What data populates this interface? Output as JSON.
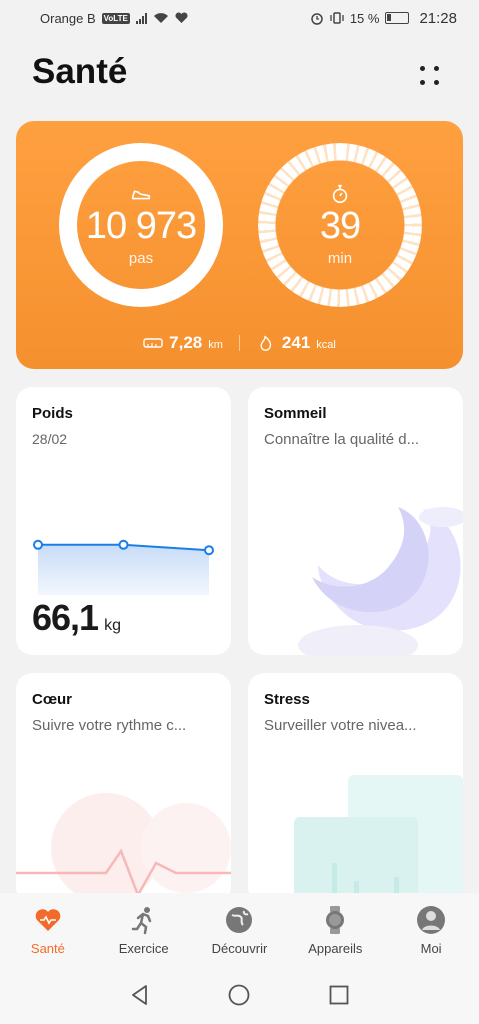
{
  "status_bar": {
    "carrier": "Orange B",
    "volte": "VoLTE",
    "battery_percent": "15 %",
    "time": "21:28"
  },
  "header": {
    "title": "Santé",
    "menu_icon": "more-dots-icon"
  },
  "activity": {
    "steps_value": "10 973",
    "steps_unit": "pas",
    "steps_icon": "shoe-icon",
    "minutes_value": "39",
    "minutes_unit": "min",
    "minutes_icon": "stopwatch-icon",
    "distance_value": "7,28",
    "distance_unit": "km",
    "calories_value": "241",
    "calories_unit": "kcal",
    "accent": "#f7922f"
  },
  "tiles": {
    "weight": {
      "title": "Poids",
      "date": "28/02",
      "value": "66,1",
      "unit": "kg",
      "chart_points": [
        0.58,
        0.58,
        0.52
      ]
    },
    "sleep": {
      "title": "Sommeil",
      "subtitle": "Connaître la qualité d..."
    },
    "heart": {
      "title": "Cœur",
      "subtitle": "Suivre votre rythme c..."
    },
    "stress": {
      "title": "Stress",
      "subtitle": "Surveiller votre nivea..."
    }
  },
  "nav": {
    "items": [
      {
        "label": "Santé",
        "icon": "heart-icon",
        "active": true
      },
      {
        "label": "Exercice",
        "icon": "runner-icon",
        "active": false
      },
      {
        "label": "Découvrir",
        "icon": "compass-icon",
        "active": false
      },
      {
        "label": "Appareils",
        "icon": "watch-icon",
        "active": false
      },
      {
        "label": "Moi",
        "icon": "profile-icon",
        "active": false
      }
    ],
    "active_color": "#f36b2b"
  },
  "system_nav": {
    "back": "back-triangle-icon",
    "home": "home-circle-icon",
    "recents": "recents-square-icon"
  }
}
